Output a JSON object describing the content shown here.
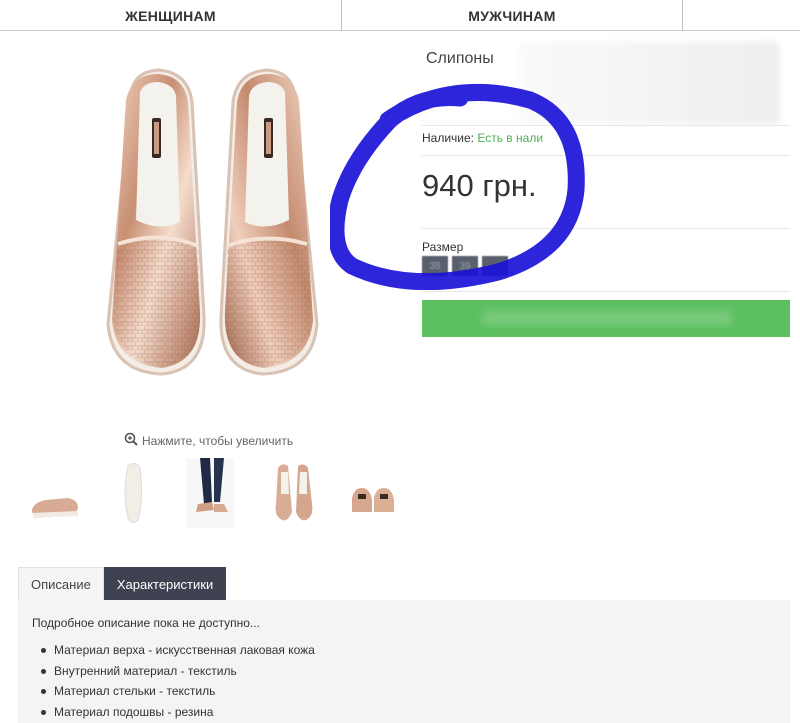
{
  "nav": {
    "items": [
      {
        "label": "ЖЕНЩИНАМ"
      },
      {
        "label": "МУЖЧИНАМ"
      },
      {
        "label": ""
      }
    ]
  },
  "product": {
    "title": "Слипоны",
    "availability_label": "Наличие:",
    "availability_value": "Есть в нали",
    "price": "940 грн.",
    "size_label": "Размер",
    "sizes": [
      "38",
      "39",
      ""
    ],
    "buy_button_label": ""
  },
  "gallery": {
    "zoom_hint": "Нажмите, чтобы увеличить",
    "zoom_icon": "zoom-in-icon",
    "thumbnails": [
      "side-view",
      "sole-view",
      "on-feet",
      "top-pair",
      "front-pair"
    ]
  },
  "tabs": {
    "items": [
      {
        "label": "Описание",
        "active": false
      },
      {
        "label": "Характеристики",
        "active": true
      }
    ]
  },
  "description": {
    "lead": "Подробное описание пока не доступно...",
    "bullets": [
      "Материал верха - искусственная лаковая кожа",
      "Внутренний материал - текстиль",
      "Материал стельки - текстиль",
      "Материал подошвы - резина"
    ]
  },
  "colors": {
    "accent_green": "#5cbf60",
    "in_stock_text": "#4caf50",
    "tab_active": "#3f4251",
    "scribble_blue": "#1a12d6"
  }
}
